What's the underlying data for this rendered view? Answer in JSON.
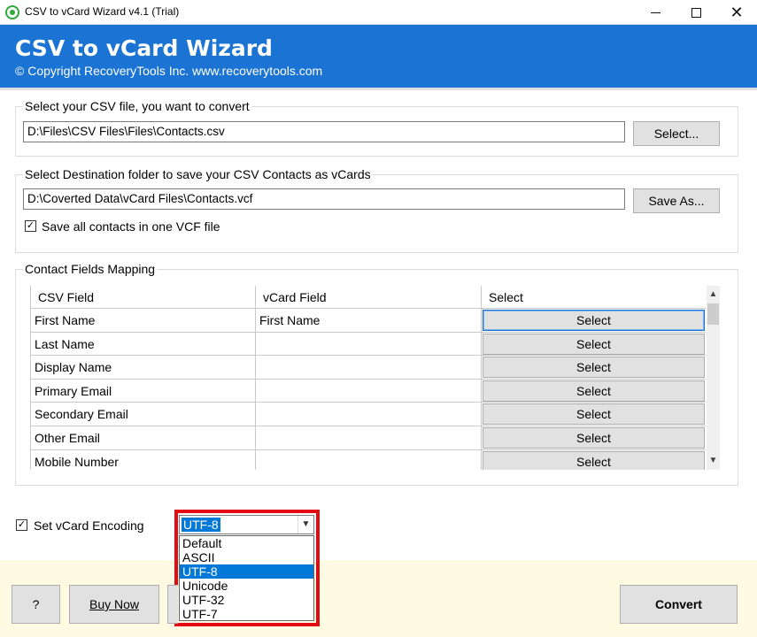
{
  "window": {
    "title": "CSV to vCard Wizard v4.1 (Trial)",
    "min_icon": "minimize-icon",
    "max_icon": "maximize-icon",
    "close_glyph": "✕"
  },
  "banner": {
    "title": "CSV to vCard Wizard",
    "copyright": "© Copyright RecoveryTools Inc. www.recoverytools.com",
    "color": "#1b73d3"
  },
  "source": {
    "group_label": "Select your CSV file, you want to convert",
    "path": "D:\\Files\\CSV Files\\Files\\Contacts.csv",
    "button": "Select..."
  },
  "destination": {
    "group_label": "Select Destination folder to save your CSV Contacts as vCards",
    "path": "D:\\Coverted Data\\vCard Files\\Contacts.vcf",
    "button": "Save As...",
    "single_file_checked": true,
    "single_file_label": "Save all contacts in one VCF file"
  },
  "mapping": {
    "group_label": "Contact Fields Mapping",
    "columns": [
      "CSV Field",
      "vCard Field",
      "Select"
    ],
    "rows": [
      {
        "csv": "First Name",
        "vcard": "First Name",
        "select": "Select"
      },
      {
        "csv": "Last Name",
        "vcard": "",
        "select": "Select"
      },
      {
        "csv": "Display Name",
        "vcard": "",
        "select": "Select"
      },
      {
        "csv": "Primary Email",
        "vcard": "",
        "select": "Select"
      },
      {
        "csv": "Secondary Email",
        "vcard": "",
        "select": "Select"
      },
      {
        "csv": "Other Email",
        "vcard": "",
        "select": "Select"
      },
      {
        "csv": "Mobile Number",
        "vcard": "",
        "select": "Select"
      }
    ]
  },
  "encoding": {
    "checked": true,
    "label": "Set vCard Encoding",
    "selected": "UTF-8",
    "options": [
      "Default",
      "ASCII",
      "UTF-8",
      "Unicode",
      "UTF-32",
      "UTF-7"
    ],
    "highlight_color": "#e30a13"
  },
  "footer": {
    "help": "?",
    "buy_now": "Buy Now",
    "convert": "Convert"
  }
}
